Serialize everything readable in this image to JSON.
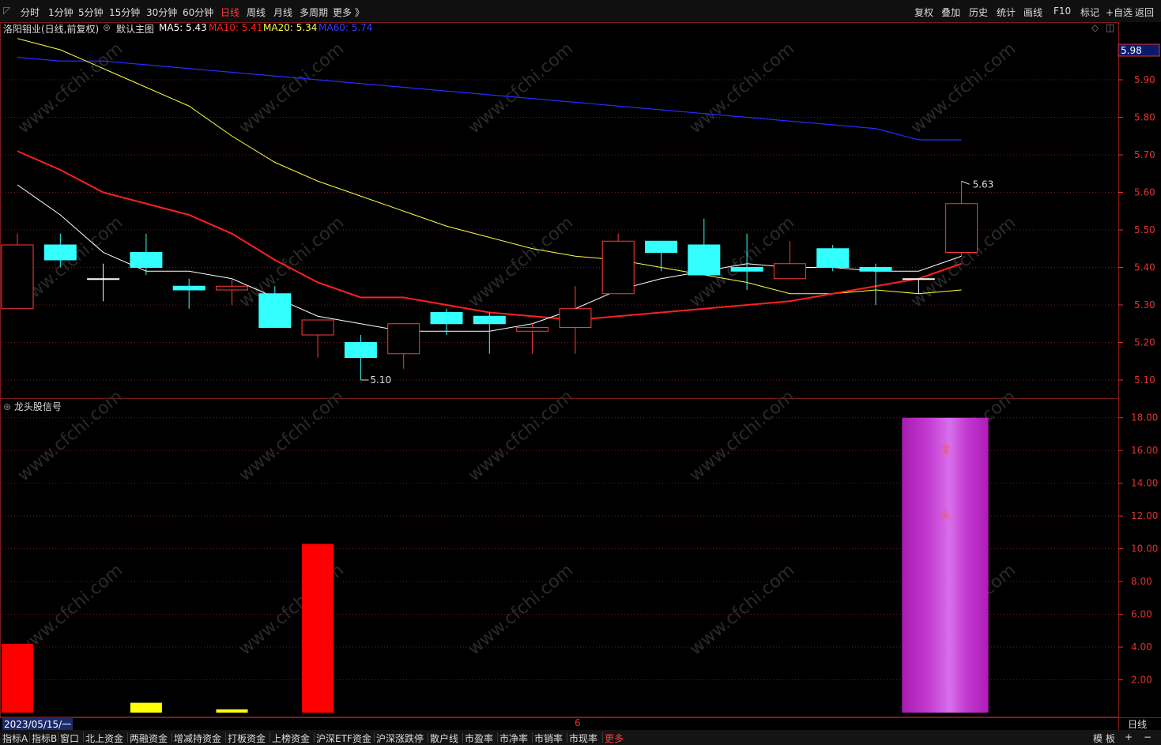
{
  "toolbar": {
    "periods": [
      "分时",
      "1分钟",
      "5分钟",
      "15分钟",
      "30分钟",
      "60分钟",
      "日线",
      "周线",
      "月线",
      "多周期",
      "更多 》"
    ],
    "active_period": "日线",
    "right_buttons": [
      "复权",
      "叠加",
      "历史",
      "统计",
      "画线",
      "F10",
      "标记",
      "+自选",
      "返回"
    ]
  },
  "info": {
    "stock": "洛阳钼业(日线,前复权)",
    "template": "默认主图",
    "ma5": "MA5: 5.43",
    "ma10": "MA10: 5.41",
    "ma20": "MA20: 5.34",
    "ma60": "MA60: 5.74"
  },
  "colors": {
    "ma5": "#ffffff",
    "ma10": "#ff2020",
    "ma20": "#ffff40",
    "ma60": "#2a2aff",
    "up": "#ff3b3b",
    "down": "#33ffff",
    "grid": "#7a1a1a"
  },
  "price_axis": {
    "ticks": [
      "5.90",
      "5.80",
      "5.70",
      "5.60",
      "5.50",
      "5.40",
      "5.30",
      "5.20",
      "5.10"
    ],
    "current": "5.98"
  },
  "indicator_axis": {
    "ticks": [
      "18.00",
      "16.00",
      "14.00",
      "12.00",
      "10.00",
      "8.00",
      "6.00",
      "4.00",
      "2.00"
    ]
  },
  "indicator": {
    "name": "龙头股信号",
    "label_chars": [
      "龙",
      "头"
    ]
  },
  "annotations": {
    "high": "5.63",
    "low": "5.10"
  },
  "watermark": "www.cfchi.com",
  "date": {
    "start": "2023/05/15/一",
    "mid_marker": "6",
    "period": "日线"
  },
  "bottom_tabs": [
    "指标A",
    "指标B",
    "窗口",
    "北上资金",
    "两融资金",
    "增减持资金",
    "打板资金",
    "上榜资金",
    "沪深ETF资金",
    "沪深涨跌停",
    "散户线",
    "市盈率",
    "市净率",
    "市销率",
    "市现率",
    "更多"
  ],
  "bottom_right": [
    "模 板",
    "+",
    "−"
  ],
  "chart_data": {
    "type": "candlestick",
    "price_range": [
      5.06,
      6.02
    ],
    "candles": [
      {
        "o": 5.29,
        "h": 5.49,
        "l": 5.29,
        "c": 5.46
      },
      {
        "o": 5.46,
        "h": 5.49,
        "l": 5.4,
        "c": 5.42
      },
      {
        "o": 5.37,
        "h": 5.41,
        "l": 5.31,
        "c": 5.37
      },
      {
        "o": 5.44,
        "h": 5.49,
        "l": 5.38,
        "c": 5.4
      },
      {
        "o": 5.35,
        "h": 5.37,
        "l": 5.29,
        "c": 5.34
      },
      {
        "o": 5.34,
        "h": 5.37,
        "l": 5.3,
        "c": 5.35
      },
      {
        "o": 5.33,
        "h": 5.35,
        "l": 5.24,
        "c": 5.24
      },
      {
        "o": 5.22,
        "h": 5.25,
        "l": 5.16,
        "c": 5.26
      },
      {
        "o": 5.2,
        "h": 5.22,
        "l": 5.1,
        "c": 5.16
      },
      {
        "o": 5.17,
        "h": 5.25,
        "l": 5.13,
        "c": 5.25
      },
      {
        "o": 5.28,
        "h": 5.29,
        "l": 5.22,
        "c": 5.25
      },
      {
        "o": 5.27,
        "h": 5.28,
        "l": 5.17,
        "c": 5.25
      },
      {
        "o": 5.23,
        "h": 5.25,
        "l": 5.17,
        "c": 5.24
      },
      {
        "o": 5.24,
        "h": 5.35,
        "l": 5.17,
        "c": 5.29
      },
      {
        "o": 5.33,
        "h": 5.49,
        "l": 5.33,
        "c": 5.47
      },
      {
        "o": 5.47,
        "h": 5.47,
        "l": 5.39,
        "c": 5.44
      },
      {
        "o": 5.46,
        "h": 5.53,
        "l": 5.38,
        "c": 5.38
      },
      {
        "o": 5.4,
        "h": 5.49,
        "l": 5.34,
        "c": 5.39
      },
      {
        "o": 5.37,
        "h": 5.47,
        "l": 5.37,
        "c": 5.41
      },
      {
        "o": 5.45,
        "h": 5.46,
        "l": 5.39,
        "c": 5.4
      },
      {
        "o": 5.4,
        "h": 5.41,
        "l": 5.3,
        "c": 5.39
      },
      {
        "o": 5.37,
        "h": 5.37,
        "l": 5.33,
        "c": 5.37
      },
      {
        "o": 5.44,
        "h": 5.63,
        "l": 5.43,
        "c": 5.57
      }
    ],
    "ma5": [
      5.62,
      5.54,
      5.44,
      5.39,
      5.39,
      5.37,
      5.32,
      5.27,
      5.25,
      5.23,
      5.23,
      5.23,
      5.25,
      5.29,
      5.34,
      5.37,
      5.39,
      5.41,
      5.4,
      5.4,
      5.39,
      5.39,
      5.43
    ],
    "ma10": [
      5.71,
      5.66,
      5.6,
      5.57,
      5.54,
      5.49,
      5.42,
      5.36,
      5.32,
      5.32,
      5.3,
      5.28,
      5.27,
      5.26,
      5.27,
      5.28,
      5.29,
      5.3,
      5.31,
      5.33,
      5.35,
      5.37,
      5.41
    ],
    "ma20": [
      6.01,
      5.98,
      5.93,
      5.88,
      5.83,
      5.75,
      5.68,
      5.63,
      5.59,
      5.55,
      5.51,
      5.48,
      5.45,
      5.43,
      5.42,
      5.4,
      5.38,
      5.36,
      5.33,
      5.33,
      5.34,
      5.33,
      5.34
    ],
    "ma60": [
      5.96,
      5.95,
      5.95,
      5.94,
      5.93,
      5.92,
      5.91,
      5.9,
      5.89,
      5.88,
      5.87,
      5.86,
      5.85,
      5.84,
      5.83,
      5.82,
      5.81,
      5.8,
      5.79,
      5.78,
      5.77,
      5.74,
      5.74
    ],
    "ma60_start": 0,
    "indicator_range": [
      0,
      19
    ],
    "indicator_bars": [
      {
        "i": 0,
        "v": 4.2,
        "color": "#ff0000"
      },
      {
        "i": 3,
        "v": 0.6,
        "color": "#ffff00"
      },
      {
        "i": 5,
        "v": 0.2,
        "color": "#ffff00"
      },
      {
        "i": 7,
        "v": 10.3,
        "color": "#ff0000"
      }
    ],
    "signal_span": {
      "from": 21,
      "to": 22,
      "v": 18.0
    }
  }
}
